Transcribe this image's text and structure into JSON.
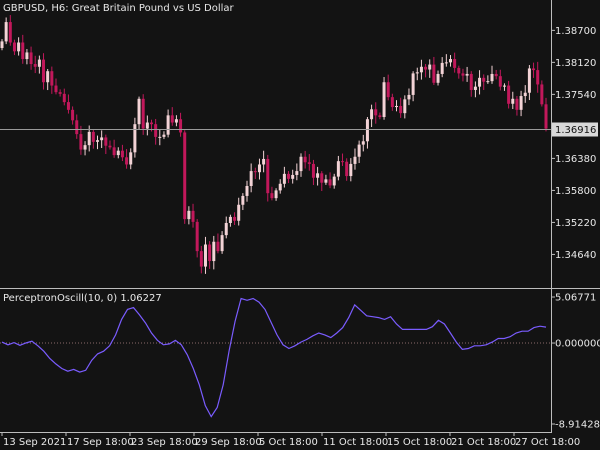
{
  "window": {
    "symbol_header": "GBPUSD, H6:  Great Britain Pound vs US Dollar",
    "oscillator_header": "PerceptronOscill(10, 0) 1.06227"
  },
  "colors": {
    "background": "#131313",
    "bull_candle": "#f3d3d6",
    "bear_candle": "#c2185b",
    "oscillator_line": "#7a5cff",
    "price_line": "#9a9a9a",
    "price_label_bg": "#d9d9d9",
    "price_label_fg": "#111111"
  },
  "chart_data": [
    {
      "type": "candlestick",
      "title": "GBPUSD, H6:  Great Britain Pound vs US Dollar",
      "ylim": [
        1.3405,
        1.3925
      ],
      "y_ticks": [
        "1.38700",
        "1.38120",
        "1.37540",
        "1.36380",
        "1.35800",
        "1.35220",
        "1.34640"
      ],
      "current_price": "1.36916",
      "x_ticks": [
        "13 Sep 2021",
        "17 Sep 18:00",
        "23 Sep 18:00",
        "29 Sep 18:00",
        "5 Oct 18:00",
        "11 Oct 18:00",
        "15 Oct 18:00",
        "21 Oct 18:00",
        "27 Oct 18:00"
      ],
      "closes": [
        1.385,
        1.3885,
        1.3848,
        1.3832,
        1.3848,
        1.3818,
        1.383,
        1.3809,
        1.3804,
        1.3817,
        1.3776,
        1.3796,
        1.377,
        1.3758,
        1.3755,
        1.374,
        1.3726,
        1.3707,
        1.3682,
        1.3654,
        1.3662,
        1.3686,
        1.3668,
        1.3671,
        1.3676,
        1.3661,
        1.3658,
        1.3644,
        1.3652,
        1.364,
        1.3627,
        1.3649,
        1.37,
        1.3746,
        1.3692,
        1.3703,
        1.37,
        1.3677,
        1.3677,
        1.3681,
        1.3716,
        1.3703,
        1.3709,
        1.3685,
        1.3528,
        1.3543,
        1.3523,
        1.347,
        1.3442,
        1.3482,
        1.3452,
        1.3487,
        1.347,
        1.3499,
        1.3521,
        1.3532,
        1.3525,
        1.3554,
        1.357,
        1.3588,
        1.3615,
        1.3613,
        1.3627,
        1.3637,
        1.3575,
        1.3566,
        1.358,
        1.3592,
        1.361,
        1.3601,
        1.3608,
        1.3615,
        1.3641,
        1.3631,
        1.3628,
        1.3603,
        1.3611,
        1.3594,
        1.36,
        1.3589,
        1.3605,
        1.3633,
        1.3632,
        1.3606,
        1.3628,
        1.3641,
        1.3663,
        1.3669,
        1.3709,
        1.3727,
        1.3716,
        1.3713,
        1.3776,
        1.3749,
        1.3731,
        1.3733,
        1.372,
        1.3745,
        1.3753,
        1.3792,
        1.3794,
        1.3804,
        1.3799,
        1.3808,
        1.3775,
        1.3791,
        1.3811,
        1.3812,
        1.3818,
        1.3802,
        1.3792,
        1.3788,
        1.3791,
        1.3762,
        1.3768,
        1.3784,
        1.3777,
        1.3778,
        1.3791,
        1.3787,
        1.3768,
        1.377,
        1.3737,
        1.3746,
        1.3726,
        1.3751,
        1.3757,
        1.3801,
        1.3798,
        1.3772,
        1.3736,
        1.3692
      ]
    },
    {
      "type": "line",
      "title": "PerceptronOscill(10, 0) 1.06227",
      "ylim": [
        -8.91428,
        5.06771
      ],
      "y_ticks": [
        "5.06771",
        "0.000000",
        "-8.91428"
      ],
      "zero_level": 0,
      "values": [
        0.1,
        -0.2,
        0.05,
        -0.25,
        0.0,
        0.2,
        -0.3,
        -0.9,
        -1.7,
        -2.3,
        -2.8,
        -3.1,
        -2.9,
        -3.2,
        -3.0,
        -1.9,
        -1.2,
        -0.9,
        -0.3,
        0.9,
        2.6,
        3.7,
        3.9,
        3.1,
        2.2,
        1.1,
        0.3,
        -0.2,
        -0.1,
        0.3,
        -0.2,
        -1.3,
        -2.8,
        -4.6,
        -6.9,
        -8.1,
        -7.1,
        -4.6,
        -0.8,
        2.4,
        4.9,
        4.7,
        4.9,
        4.5,
        3.7,
        2.3,
        0.9,
        -0.2,
        -0.6,
        -0.3,
        0.1,
        0.4,
        0.8,
        1.1,
        0.9,
        0.6,
        1.1,
        1.7,
        2.8,
        4.2,
        3.6,
        3.0,
        2.9,
        2.8,
        2.6,
        2.9,
        2.1,
        1.5,
        1.5,
        1.5,
        1.5,
        1.5,
        1.8,
        2.5,
        2.1,
        1.1,
        0.1,
        -0.7,
        -0.6,
        -0.3,
        -0.3,
        -0.2,
        0.1,
        0.5,
        0.5,
        0.7,
        1.1,
        1.3,
        1.3,
        1.7,
        1.85,
        1.75
      ]
    }
  ]
}
